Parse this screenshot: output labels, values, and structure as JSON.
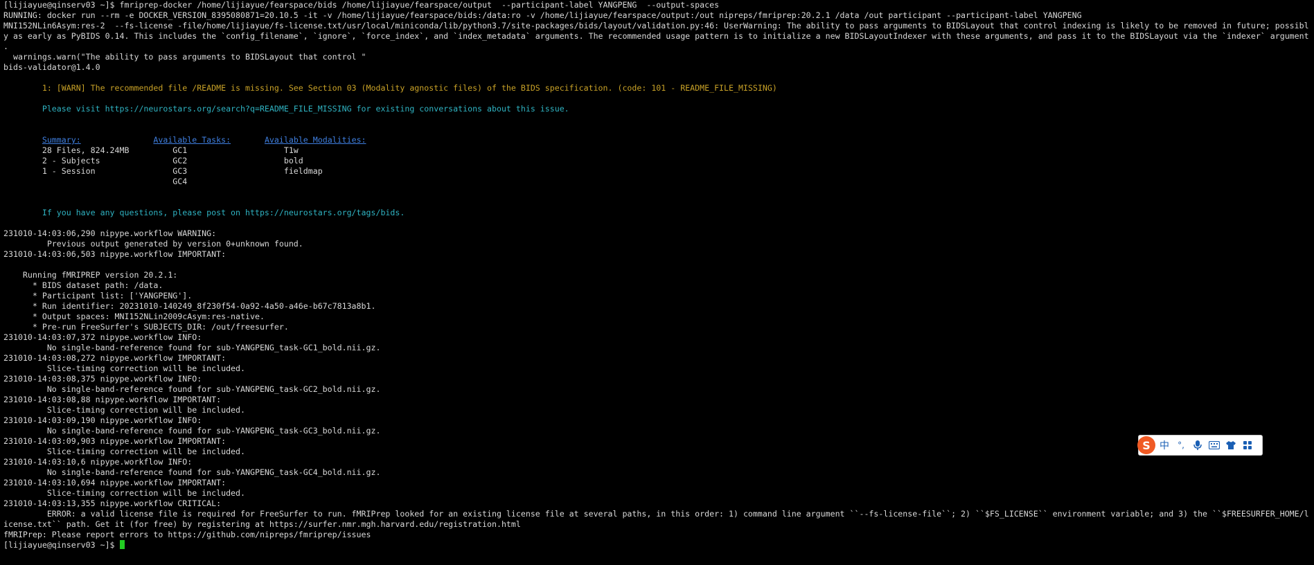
{
  "terminal": {
    "lines": [
      {
        "text": "[lijiayue@qinserv03 ~]$ fmriprep-docker /home/lijiayue/fearspace/bids /home/lijiayue/fearspace/output  --participant-label YANGPENG  --output-spaces",
        "style": "normal"
      },
      {
        "text": "RUNNING: docker run --rm -e DOCKER_VERSION_8395080871=20.10.5 -it -v /home/lijiayue/fearspace/bids:/data:ro -v /home/lijiayue/fearspace/output:/out nipreps/fmriprep:20.2.1 /data /out participant --participant-label YANGPENG",
        "style": "normal"
      },
      {
        "text": "MNI152NLin6Asym:res-2  --fs-license -file/home/lijiayue/fs-license.txt/usr/local/miniconda/lib/python3.7/site-packages/bids/layout/validation.py:46: UserWarning: The ability to pass arguments to BIDSLayout that control indexing is likely to be removed in future; possibl",
        "style": "normal"
      },
      {
        "text": "y as early as PyBIDS 0.14. This includes the `config_filename`, `ignore`, `force_index`, and `index_metadata` arguments. The recommended usage pattern is to initialize a new BIDSLayoutIndexer with these arguments, and pass it to the BIDSLayout via the `indexer` argument",
        "style": "normal"
      },
      {
        "text": ".",
        "style": "normal"
      },
      {
        "text": "  warnings.warn(\"The ability to pass arguments to BIDSLayout that control \"",
        "style": "normal"
      },
      {
        "text": "bids-validator@1.4.0",
        "style": "normal"
      },
      {
        "text": "",
        "style": "normal"
      },
      {
        "text": "        1: [WARN] The recommended file /README is missing. See Section 03 (Modality agnostic files) of the BIDS specification. (code: 101 - README_FILE_MISSING)",
        "style": "warn"
      },
      {
        "text": "",
        "style": "normal"
      },
      {
        "text": "        Please visit https://neurostars.org/search?q=README_FILE_MISSING for existing conversations about this issue.",
        "style": "cyan"
      },
      {
        "text": "",
        "style": "normal"
      },
      {
        "text": "",
        "style": "normal"
      },
      {
        "text": "",
        "style": "summary-header"
      },
      {
        "text": "        28 Files, 824.24MB         GC1                    T1w",
        "style": "normal"
      },
      {
        "text": "        2 - Subjects               GC2                    bold",
        "style": "normal"
      },
      {
        "text": "        1 - Session                GC3                    fieldmap",
        "style": "normal"
      },
      {
        "text": "                                   GC4",
        "style": "normal"
      },
      {
        "text": "",
        "style": "normal"
      },
      {
        "text": "",
        "style": "normal"
      },
      {
        "text": "        If you have any questions, please post on https://neurostars.org/tags/bids.",
        "style": "cyan"
      },
      {
        "text": "",
        "style": "normal"
      },
      {
        "text": "231010-14:03:06,290 nipype.workflow WARNING:",
        "style": "normal"
      },
      {
        "text": "         Previous output generated by version 0+unknown found.",
        "style": "normal"
      },
      {
        "text": "231010-14:03:06,503 nipype.workflow IMPORTANT:",
        "style": "normal"
      },
      {
        "text": "",
        "style": "normal"
      },
      {
        "text": "    Running fMRIPREP version 20.2.1:",
        "style": "normal"
      },
      {
        "text": "      * BIDS dataset path: /data.",
        "style": "normal"
      },
      {
        "text": "      * Participant list: ['YANGPENG'].",
        "style": "normal"
      },
      {
        "text": "      * Run identifier: 20231010-140249_8f230f54-0a92-4a50-a46e-b67c7813a8b1.",
        "style": "normal"
      },
      {
        "text": "      * Output spaces: MNI152NLin2009cAsym:res-native.",
        "style": "normal"
      },
      {
        "text": "      * Pre-run FreeSurfer's SUBJECTS_DIR: /out/freesurfer.",
        "style": "normal"
      },
      {
        "text": "231010-14:03:07,372 nipype.workflow INFO:",
        "style": "normal"
      },
      {
        "text": "         No single-band-reference found for sub-YANGPENG_task-GC1_bold.nii.gz.",
        "style": "normal"
      },
      {
        "text": "231010-14:03:08,272 nipype.workflow IMPORTANT:",
        "style": "normal"
      },
      {
        "text": "         Slice-timing correction will be included.",
        "style": "normal"
      },
      {
        "text": "231010-14:03:08,375 nipype.workflow INFO:",
        "style": "normal"
      },
      {
        "text": "         No single-band-reference found for sub-YANGPENG_task-GC2_bold.nii.gz.",
        "style": "normal"
      },
      {
        "text": "231010-14:03:08,88 nipype.workflow IMPORTANT:",
        "style": "normal"
      },
      {
        "text": "         Slice-timing correction will be included.",
        "style": "normal"
      },
      {
        "text": "231010-14:03:09,190 nipype.workflow INFO:",
        "style": "normal"
      },
      {
        "text": "         No single-band-reference found for sub-YANGPENG_task-GC3_bold.nii.gz.",
        "style": "normal"
      },
      {
        "text": "231010-14:03:09,903 nipype.workflow IMPORTANT:",
        "style": "normal"
      },
      {
        "text": "         Slice-timing correction will be included.",
        "style": "normal"
      },
      {
        "text": "231010-14:03:10,6 nipype.workflow INFO:",
        "style": "normal"
      },
      {
        "text": "         No single-band-reference found for sub-YANGPENG_task-GC4_bold.nii.gz.",
        "style": "normal"
      },
      {
        "text": "231010-14:03:10,694 nipype.workflow IMPORTANT:",
        "style": "normal"
      },
      {
        "text": "         Slice-timing correction will be included.",
        "style": "normal"
      },
      {
        "text": "231010-14:03:13,355 nipype.workflow CRITICAL:",
        "style": "normal"
      },
      {
        "text": "         ERROR: a valid license file is required for FreeSurfer to run. fMRIPrep looked for an existing license file at several paths, in this order: 1) command line argument ``--fs-license-file``; 2) ``$FS_LICENSE`` environment variable; and 3) the ``$FREESURFER_HOME/l",
        "style": "normal"
      },
      {
        "text": "icense.txt`` path. Get it (for free) by registering at https://surfer.nmr.mgh.harvard.edu/registration.html",
        "style": "normal"
      },
      {
        "text": "fMRIPrep: Please report errors to https://github.com/nipreps/fmriprep/issues",
        "style": "normal"
      },
      {
        "text": "[lijiayue@qinserv03 ~]$ ",
        "style": "prompt"
      }
    ],
    "summary_headers": {
      "summary": "Summary:",
      "tasks": "Available Tasks:",
      "modalities": "Available Modalities:"
    }
  },
  "ime_toolbar": {
    "logo": "S",
    "lang": "中",
    "punct": "°,",
    "mic_icon": "microphone-icon",
    "keyboard_icon": "keyboard-icon",
    "skin_icon": "shirt-icon",
    "menu_icon": "grid-menu-icon"
  }
}
